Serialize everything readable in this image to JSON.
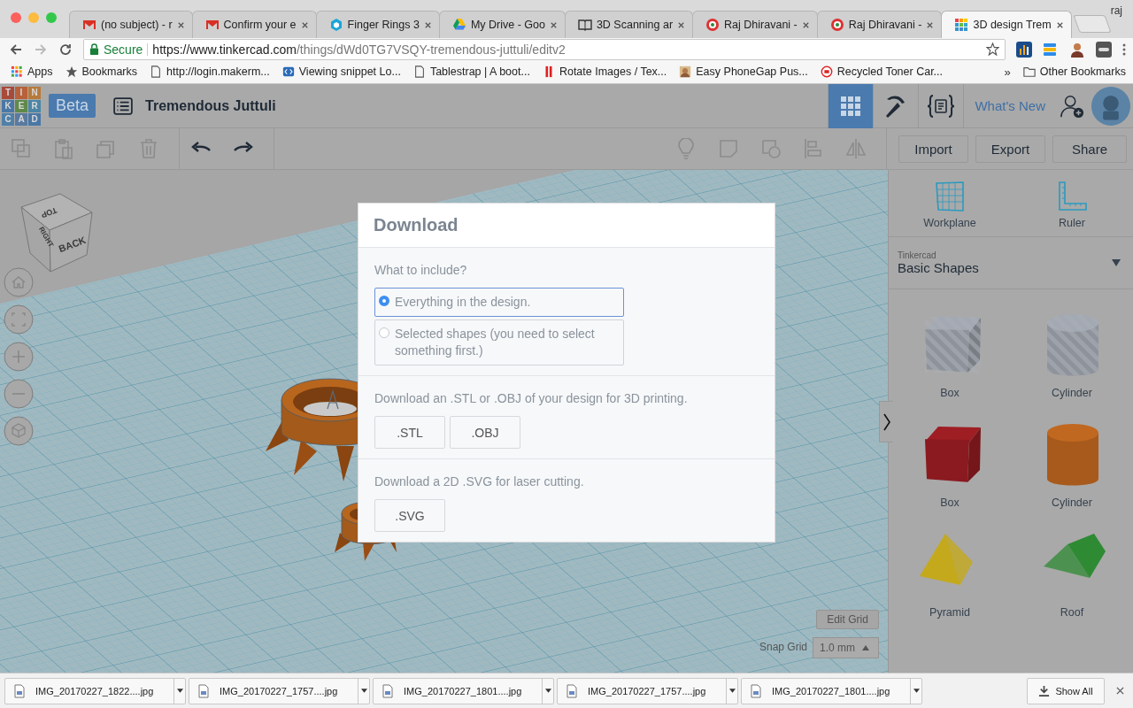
{
  "browser": {
    "tabs": [
      {
        "title": "(no subject) - r",
        "kind": "mail",
        "selected": false
      },
      {
        "title": "Confirm your e",
        "kind": "mail",
        "selected": false
      },
      {
        "title": "Finger Rings 3",
        "kind": "hex",
        "selected": false
      },
      {
        "title": "My Drive - Goo",
        "kind": "drive",
        "selected": false
      },
      {
        "title": "3D Scanning ar",
        "kind": "book",
        "selected": false
      },
      {
        "title": "Raj Dhiravani -",
        "kind": "wheel",
        "selected": false
      },
      {
        "title": "Raj Dhiravani -",
        "kind": "wheel",
        "selected": false
      },
      {
        "title": "3D design Trem",
        "kind": "squares",
        "selected": true
      }
    ],
    "profile": "raj",
    "address": {
      "security": "Secure",
      "url_host": "https://www.tinkercad.com",
      "url_path": "/things/dWd0TG7VSQY-tremendous-juttuli/editv2"
    },
    "bookmarks": [
      {
        "label": "Apps",
        "kind": "apps"
      },
      {
        "label": "Bookmarks",
        "kind": "star"
      },
      {
        "label": "http://login.makerm...",
        "kind": "page"
      },
      {
        "label": "Viewing snippet Lo...",
        "kind": "tag"
      },
      {
        "label": "Tablestrap | A boot...",
        "kind": "page"
      },
      {
        "label": "Rotate Images / Tex...",
        "kind": "bars"
      },
      {
        "label": "Easy PhoneGap Pus...",
        "kind": "photo"
      },
      {
        "label": "Recycled Toner Car...",
        "kind": "ring"
      }
    ],
    "bookmarks_overflow": "»",
    "other_bookmarks": "Other Bookmarks"
  },
  "app": {
    "logo": [
      {
        "letter": "T",
        "color": "#a84a3a"
      },
      {
        "letter": "I",
        "color": "#b8613a"
      },
      {
        "letter": "N",
        "color": "#b87a3a"
      },
      {
        "letter": "K",
        "color": "#4a78a6"
      },
      {
        "letter": "E",
        "color": "#5f8a4a"
      },
      {
        "letter": "R",
        "color": "#4a86a6"
      },
      {
        "letter": "C",
        "color": "#4f80a8"
      },
      {
        "letter": "A",
        "color": "#5a7aa0"
      },
      {
        "letter": "D",
        "color": "#4a78a6"
      }
    ],
    "badge": "Beta",
    "title": "Tremendous Juttuli",
    "views": [
      {
        "kind": "grid",
        "selected": true
      },
      {
        "kind": "pickaxe",
        "selected": false
      },
      {
        "kind": "code",
        "selected": false
      }
    ],
    "whats_new": "What's New"
  },
  "toolbar": {
    "edit_tools": [
      {
        "kind": "copy",
        "disabled": true
      },
      {
        "kind": "paste",
        "disabled": true
      },
      {
        "kind": "duplicate",
        "disabled": true
      },
      {
        "kind": "delete",
        "disabled": true
      }
    ],
    "history_tools": [
      {
        "kind": "undo",
        "disabled": false
      },
      {
        "kind": "redo",
        "disabled": false
      }
    ],
    "shape_tools": [
      {
        "kind": "bulb",
        "disabled": true
      },
      {
        "kind": "note",
        "disabled": true
      },
      {
        "kind": "combine",
        "disabled": true
      },
      {
        "kind": "align",
        "disabled": true
      },
      {
        "kind": "mirror",
        "disabled": true
      }
    ],
    "buttons": [
      "Import",
      "Export",
      "Share"
    ]
  },
  "canvas": {
    "view_cube": [
      "TOP",
      "RIGHT",
      "BACK"
    ],
    "nav": [
      {
        "kind": "home"
      },
      {
        "kind": "fit"
      },
      {
        "kind": "zoom-in"
      },
      {
        "kind": "zoom-out"
      },
      {
        "kind": "perspective"
      }
    ],
    "edit_grid": "Edit Grid",
    "snap_label": "Snap Grid",
    "snap_value": "1.0 mm"
  },
  "panel": {
    "tools": [
      {
        "label": "Workplane",
        "kind": "workplane"
      },
      {
        "label": "Ruler",
        "kind": "ruler"
      }
    ],
    "library_source": "Tinkercad",
    "library": "Basic Shapes",
    "shapes": [
      {
        "label": "Box",
        "kind": "box",
        "hole": true,
        "color": "#8e939b"
      },
      {
        "label": "Cylinder",
        "kind": "cylinder",
        "hole": true,
        "color": "#8e939b"
      },
      {
        "label": "Box",
        "kind": "box",
        "hole": false,
        "color": "#8a1a1f"
      },
      {
        "label": "Cylinder",
        "kind": "cylinder",
        "hole": false,
        "color": "#a85a1c"
      },
      {
        "label": "Pyramid",
        "kind": "pyramid",
        "hole": false,
        "color": "#c4a91c"
      },
      {
        "label": "Roof",
        "kind": "roof",
        "hole": false,
        "color": "#2f8a34"
      }
    ]
  },
  "dialog": {
    "title": "Download",
    "include_label": "What to include?",
    "options": [
      {
        "label": "Everything in the design.",
        "selected": true
      },
      {
        "label": "Selected shapes (you need to select something first.)",
        "selected": false
      }
    ],
    "sections": [
      {
        "text": "Download an .STL or .OBJ of your design for 3D printing.",
        "buttons": [
          ".STL",
          ".OBJ"
        ]
      },
      {
        "text": "Download a 2D .SVG for laser cutting.",
        "buttons": [
          ".SVG"
        ]
      }
    ]
  },
  "downloads": {
    "files": [
      "IMG_20170227_1822....jpg",
      "IMG_20170227_1757....jpg",
      "IMG_20170227_1801....jpg",
      "IMG_20170227_1757....jpg",
      "IMG_20170227_1801....jpg"
    ],
    "show_all": "Show All"
  }
}
